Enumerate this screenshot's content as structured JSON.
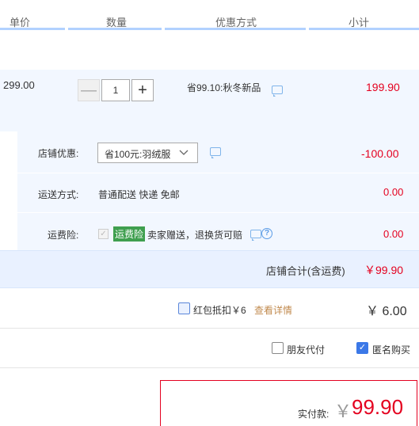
{
  "header": {
    "col_unit_price": "单价",
    "col_quantity": "数量",
    "col_discount": "优惠方式",
    "col_subtotal": "小计"
  },
  "item": {
    "unit_price": "299.00",
    "quantity": "1",
    "minus": "—",
    "plus": "+",
    "promo": "省99.10:秋冬新品",
    "subtotal": "199.90"
  },
  "shop": {
    "discount_label": "店铺优惠:",
    "discount_select": "省100元:羽绒服",
    "discount_value": "-100.00",
    "shipping_label": "运送方式:",
    "shipping_method": "普通配送 快递 免邮",
    "shipping_value": "0.00",
    "insurance_label": "运费险:",
    "insurance_badge": "运费险",
    "insurance_desc": "卖家赠送，退换货可赔",
    "insurance_value": "0.00",
    "total_label": "店铺合计(含运费)",
    "total_value": "￥99.90"
  },
  "redpacket": {
    "label": "红包抵扣￥6",
    "details_link": "查看详情",
    "amount": "￥ 6.00"
  },
  "options": {
    "friend_pay": "朋友代付",
    "anonymous": "匿名购买"
  },
  "payment": {
    "label": "实付款:",
    "currency": "￥",
    "amount": "99.90"
  },
  "colors": {
    "accent_red": "#e4001f",
    "panel_blue": "#f2f7ff",
    "badge_green": "#3f9f4f"
  }
}
